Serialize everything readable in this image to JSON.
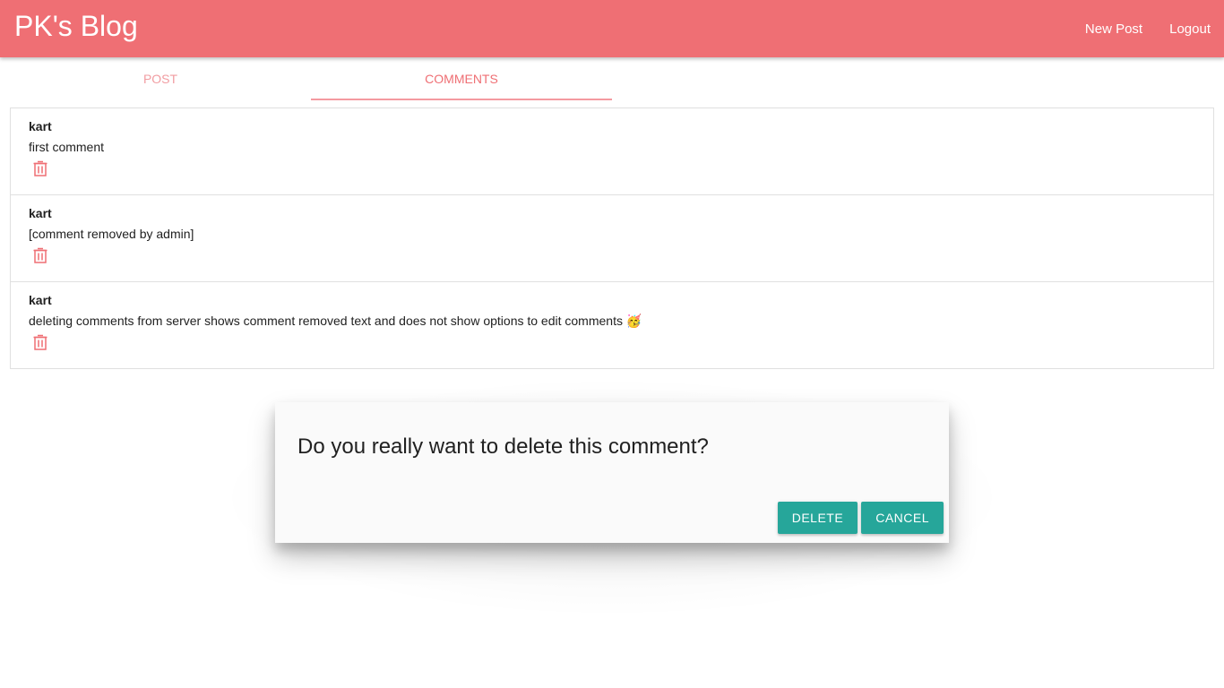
{
  "header": {
    "title": "PK's Blog",
    "links": [
      "New Post",
      "Logout"
    ]
  },
  "tabs": {
    "items": [
      "POST",
      "COMMENTS"
    ],
    "active": "COMMENTS"
  },
  "comments": [
    {
      "author": "kart",
      "text": "first comment",
      "icon": "trash-icon"
    },
    {
      "author": "kart",
      "text": "[comment removed by admin]",
      "icon": "trash-icon"
    },
    {
      "author": "kart",
      "text": "deleting comments from server shows comment removed text and does not show options to edit comments 🥳",
      "icon": "trash-icon"
    }
  ],
  "dialog": {
    "message": "Do you really want to delete this comment?",
    "confirm_label": "DELETE",
    "cancel_label": "CANCEL"
  },
  "colors": {
    "primary": "#ef6f74",
    "accent": "#26a69a",
    "icon": "#ef6f74"
  }
}
